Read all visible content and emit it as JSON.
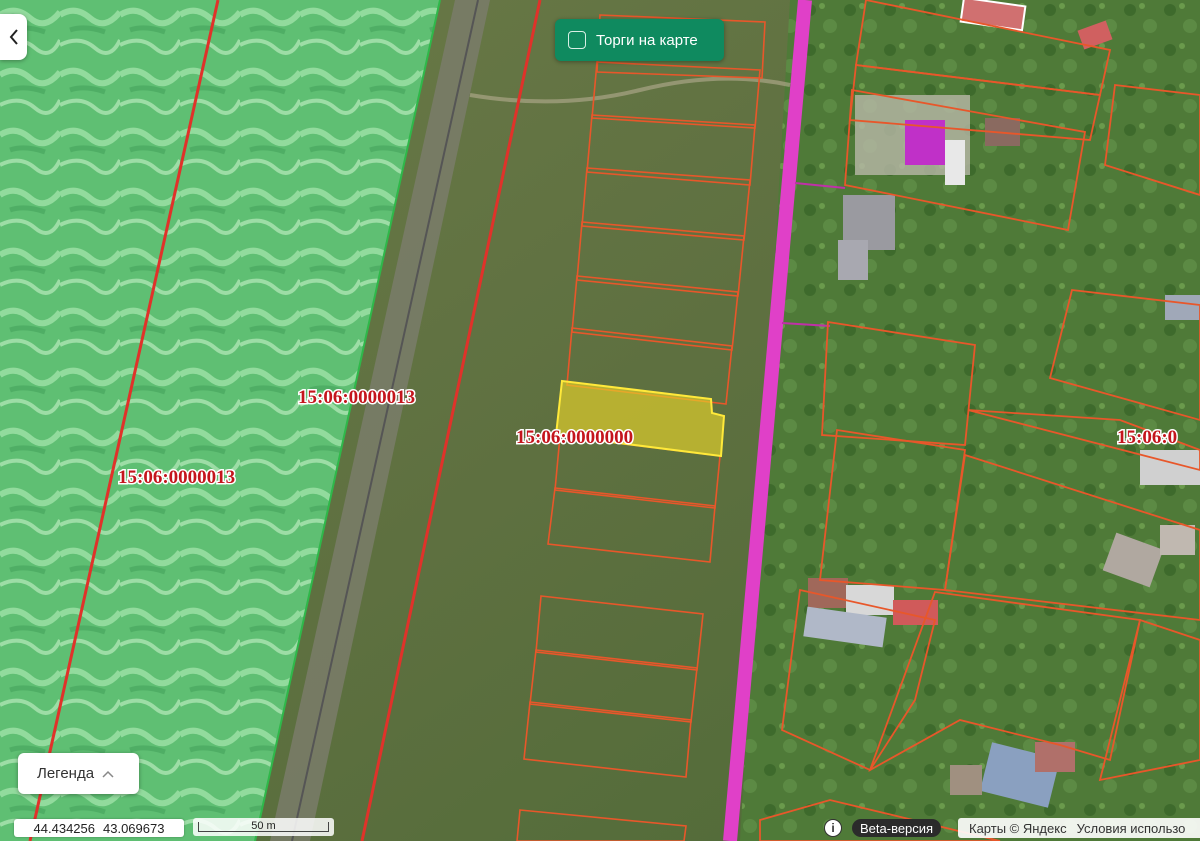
{
  "map": {
    "parcel_labels": [
      "15:06:0000013",
      "15:06:0000013",
      "15:06:0000000",
      "15:06:0"
    ]
  },
  "controls": {
    "torgi_label": "Торги на карте",
    "legend_label": "Легенда"
  },
  "status": {
    "lat": "44.434256",
    "lon": "43.069673",
    "scale_label": "50 m",
    "beta_label": "Beta-версия",
    "copyright": "Карты © Яндекс",
    "terms": "Условия использо"
  },
  "colors": {
    "parcel_border": "#e8572a",
    "quarter_border": "#e0322a",
    "road": "#e040c8",
    "selected_fill": "#e6d22a",
    "water_zone": "#6fd48a",
    "torgi_button": "#0f8a5f"
  }
}
